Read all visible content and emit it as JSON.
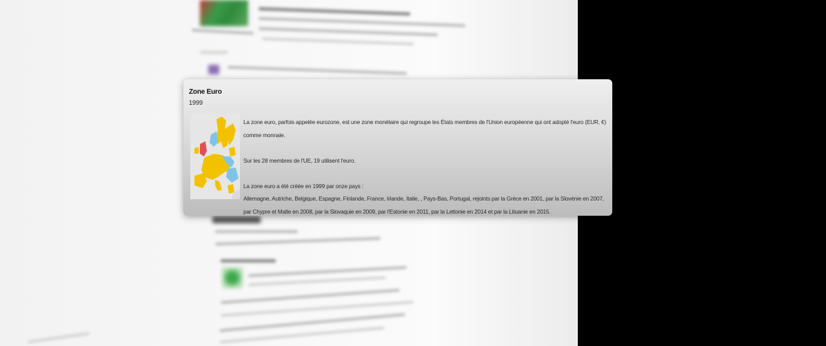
{
  "popup": {
    "title": "Zone Euro",
    "year": "1999",
    "map_image": "eurozone-map-image",
    "paragraphs": [
      "La zone euro, parfois appelée eurozone, est une zone monétaire qui regroupe les États membres de l'Union européenne qui ont adopté l'euro (EUR, €) comme monnaie.",
      "Sur les 28 membres de l'UE, 19 utilisent l'euro.",
      "La zone euro a été créée en 1999 par onze pays :",
      "Allemagne, Autriche, Belgique, Espagne, Finlande, France, Irlande, Italie, , Pays-Bas, Portugal, rejoints par la Grèce en 2001, par la Slovénie en 2007, par Chypre et Malte en 2008, par la Slovaquie en 2009, par l'Estonie en 2011, par la Lettonie en 2014 et par la Lituanie en 2015."
    ]
  },
  "colors": {
    "eurozone": "#f2c200",
    "eu_non_euro": "#7fc4e8",
    "non_eu": "#d9d9d9",
    "uk_highlight": "#e05050"
  }
}
